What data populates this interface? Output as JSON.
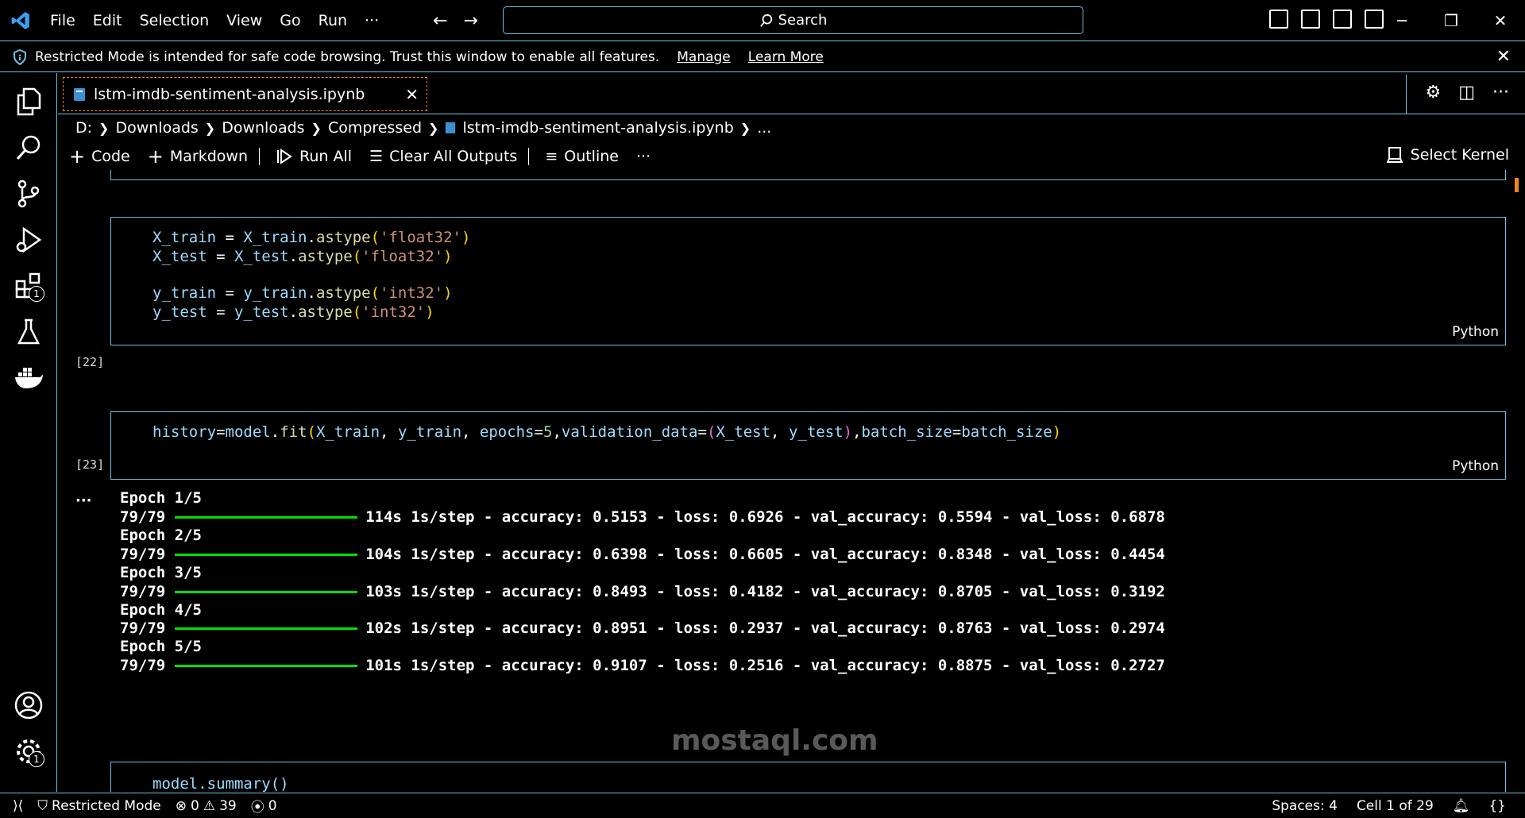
{
  "titlebar": {
    "menu": [
      "File",
      "Edit",
      "Selection",
      "View",
      "Go",
      "Run",
      "···"
    ],
    "search_label": "Search"
  },
  "banner": {
    "message": "Restricted Mode is intended for safe code browsing. Trust this window to enable all features.",
    "manage": "Manage",
    "learn_more": "Learn More"
  },
  "tab": {
    "title": "lstm-imdb-sentiment-analysis.ipynb"
  },
  "breadcrumb": [
    "D:",
    "Downloads",
    "Downloads",
    "Compressed",
    "lstm-imdb-sentiment-analysis.ipynb",
    "..."
  ],
  "toolbar": {
    "code": "Code",
    "markdown": "Markdown",
    "run_all": "Run All",
    "clear_outputs": "Clear All Outputs",
    "outline": "Outline",
    "more": "···",
    "select_kernel": "Select Kernel"
  },
  "cells": {
    "cell22": {
      "exec": "[22]",
      "lang": "Python"
    },
    "cell23": {
      "exec": "[23]",
      "lang": "Python"
    },
    "next": {
      "code": "model.summary()"
    }
  },
  "output": {
    "ellipsis": "···",
    "epochs": [
      {
        "epoch": "Epoch 1/5",
        "steps": "79/79",
        "stats": "114s 1s/step - accuracy: 0.5153 - loss: 0.6926 - val_accuracy: 0.5594 - val_loss: 0.6878"
      },
      {
        "epoch": "Epoch 2/5",
        "steps": "79/79",
        "stats": "104s 1s/step - accuracy: 0.6398 - loss: 0.6605 - val_accuracy: 0.8348 - val_loss: 0.4454"
      },
      {
        "epoch": "Epoch 3/5",
        "steps": "79/79",
        "stats": "103s 1s/step - accuracy: 0.8493 - loss: 0.4182 - val_accuracy: 0.8705 - val_loss: 0.3192"
      },
      {
        "epoch": "Epoch 4/5",
        "steps": "79/79",
        "stats": "102s 1s/step - accuracy: 0.8951 - loss: 0.2937 - val_accuracy: 0.8763 - val_loss: 0.2974"
      },
      {
        "epoch": "Epoch 5/5",
        "steps": "79/79",
        "stats": "101s 1s/step - accuracy: 0.9107 - loss: 0.2516 - val_accuracy: 0.8875 - val_loss: 0.2727"
      }
    ]
  },
  "activity_badges": {
    "extensions": "1",
    "settings": "1"
  },
  "statusbar": {
    "restricted": "Restricted Mode",
    "errors": "0",
    "warnings": "39",
    "ports": "0",
    "spaces": "Spaces: 4",
    "cell": "Cell 1 of 29"
  },
  "watermark": "mostaql.com",
  "colors": {
    "accent": "#6fc3df",
    "active_tab": "#f38518",
    "progress": "#00e000"
  }
}
